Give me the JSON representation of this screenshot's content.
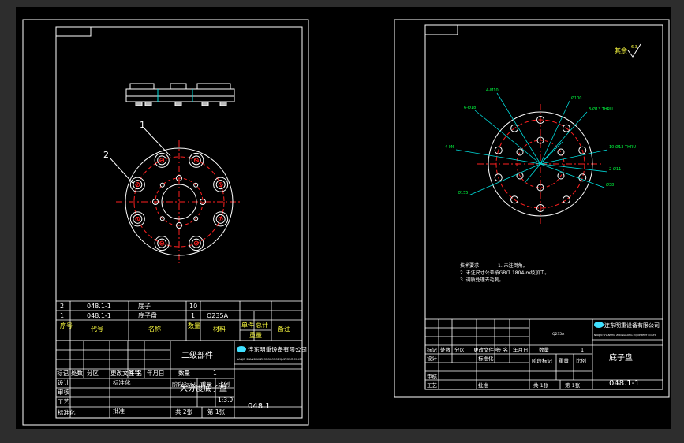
{
  "colors": {
    "bg": "#000000",
    "frame": "#ffffff",
    "center": "#ff2020",
    "dim": "#00e0e0",
    "text": "#ffffff",
    "yellow": "#ffff40",
    "green": "#00ff40",
    "title_cyan": "#40e0ff"
  },
  "sheet1": {
    "balloons": [
      "1",
      "2"
    ],
    "bom": [
      {
        "no": "2",
        "code": "048.1-1",
        "name": "底子",
        "qty": "10",
        "material": ""
      },
      {
        "no": "1",
        "code": "048.1-1",
        "name": "底子盘",
        "qty": "1",
        "material": "Q235A"
      }
    ],
    "bom_header": {
      "no": "序号",
      "code": "代号",
      "name": "名称",
      "qty": "数量",
      "material": "材料",
      "unit_weight": "单件",
      "total_weight": "总计",
      "weight": "重量",
      "remark": "备注"
    },
    "title_block": {
      "company": "连东明重设备有限公司",
      "company_en": "NANJIN SHANSHUI ZHONGGONG EQUIPMENT CO.LTD",
      "assembly": "二级部件",
      "drawing_name": "大分度底子盘",
      "drawing_no": "048.1",
      "scale": "1:3.9",
      "sheets": "共 2张",
      "sheet": "第 1张",
      "rows": [
        "标记",
        "处数",
        "分区",
        "更改文件号",
        "签 名",
        "年月日"
      ],
      "roles": [
        "设计",
        "审核",
        "工艺",
        "标准化",
        "批准"
      ],
      "stage": "阶段标记",
      "weight_lbl": "重量",
      "scale_lbl": "比例",
      "qty_lbl": "数量",
      "qty_val": "1"
    }
  },
  "sheet2": {
    "roughness": "其余",
    "roughness_val": "6.3",
    "dims": [
      "6-Ø18",
      "4-M10",
      "Ø100",
      "3-Ø13 THRU",
      "10-Ø13 THRU",
      "2-Ø11",
      "Ø38",
      "4-M6",
      "Ø155"
    ],
    "notes_title": "技术要求",
    "notes": [
      "1. 未注倒角。",
      "2. 未注尺寸公差按GB/T 1804-m级加工。",
      "3. 调质处理去毛刺。"
    ],
    "title_block": {
      "company": "连东明重设备有限公司",
      "company_en": "NANJIN SHANSHUI ZHONGGONG EQUIPMENT CO.LTD",
      "material": "Q235A",
      "drawing_name": "底子盘",
      "drawing_no": "048.1-1",
      "sheets": "共 1张",
      "sheet": "第 1张",
      "qty_lbl": "数量",
      "qty_val": "1",
      "stage": "阶段标记",
      "weight_lbl": "重量",
      "scale_lbl": "比例"
    }
  }
}
